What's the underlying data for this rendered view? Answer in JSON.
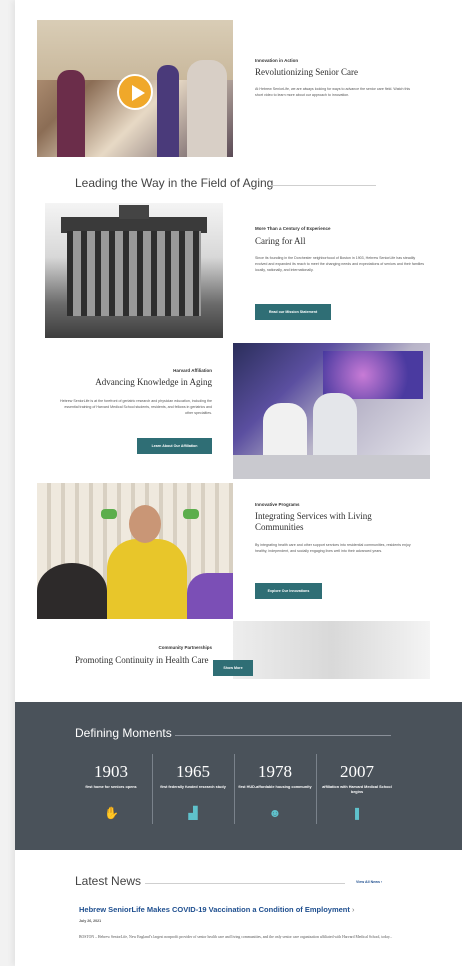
{
  "innovation": {
    "eyebrow": "Innovation in Action",
    "heading": "Revolutionizing Senior Care",
    "body": "At Hebrew SeniorLife, we are always looking for ways to advance the senior care field. Watch this short video to learn more about our approach to innovation."
  },
  "leading": {
    "title": "Leading the Way in the Field of Aging"
  },
  "caring": {
    "eyebrow": "More Than a Century of Experience",
    "heading": "Caring for All",
    "body": "Since its founding in the Dorchester neighborhood of Boston in 1903, Hebrew SeniorLife has steadily evolved and expanded its reach to meet the changing needs and expectations of seniors and their families locally, nationally, and internationally.",
    "button": "Read our Mission Statement"
  },
  "harvard": {
    "eyebrow": "Harvard Affiliation",
    "heading": "Advancing Knowledge in Aging",
    "body": "Hebrew SeniorLife is at the forefront of geriatric research and physician education, including the essential training of Harvard Medical School students, residents, and fellows in geriatrics and other specialties.",
    "button": "Learn About Our Affiliation"
  },
  "programs": {
    "eyebrow": "Innovative Programs",
    "heading": "Integrating Services with Living Communities",
    "body": "By integrating health care and other support services into residential communities, residents enjoy healthy, independent, and socially engaging lives well into their advanced years.",
    "button": "Explore Our Innovations"
  },
  "community": {
    "eyebrow": "Community Partnerships",
    "heading": "Promoting Continuity in Health Care",
    "button": "Show More"
  },
  "moments": {
    "title": "Defining Moments",
    "items": [
      {
        "year": "1903",
        "desc": "first home for seniors opens",
        "icon": "hands-icon"
      },
      {
        "year": "1965",
        "desc": "first federally funded research study",
        "icon": "chart-icon"
      },
      {
        "year": "1978",
        "desc": "first HUD-affordable housing community",
        "icon": "people-icon"
      },
      {
        "year": "2007",
        "desc": "affiliation with Harvard Medical School begins",
        "icon": "bookmark-icon"
      }
    ]
  },
  "news": {
    "title": "Latest News",
    "view_all": "View All News",
    "headline": "Hebrew SeniorLife Makes COVID-19 Vaccination a Condition of Employment",
    "date": "July 26, 2021",
    "excerpt": "BOSTON – Hebrew SeniorLife, New England’s largest nonprofit provider of senior health care and living communities, and the only senior care organization affiliated with Harvard Medical School, today..."
  }
}
